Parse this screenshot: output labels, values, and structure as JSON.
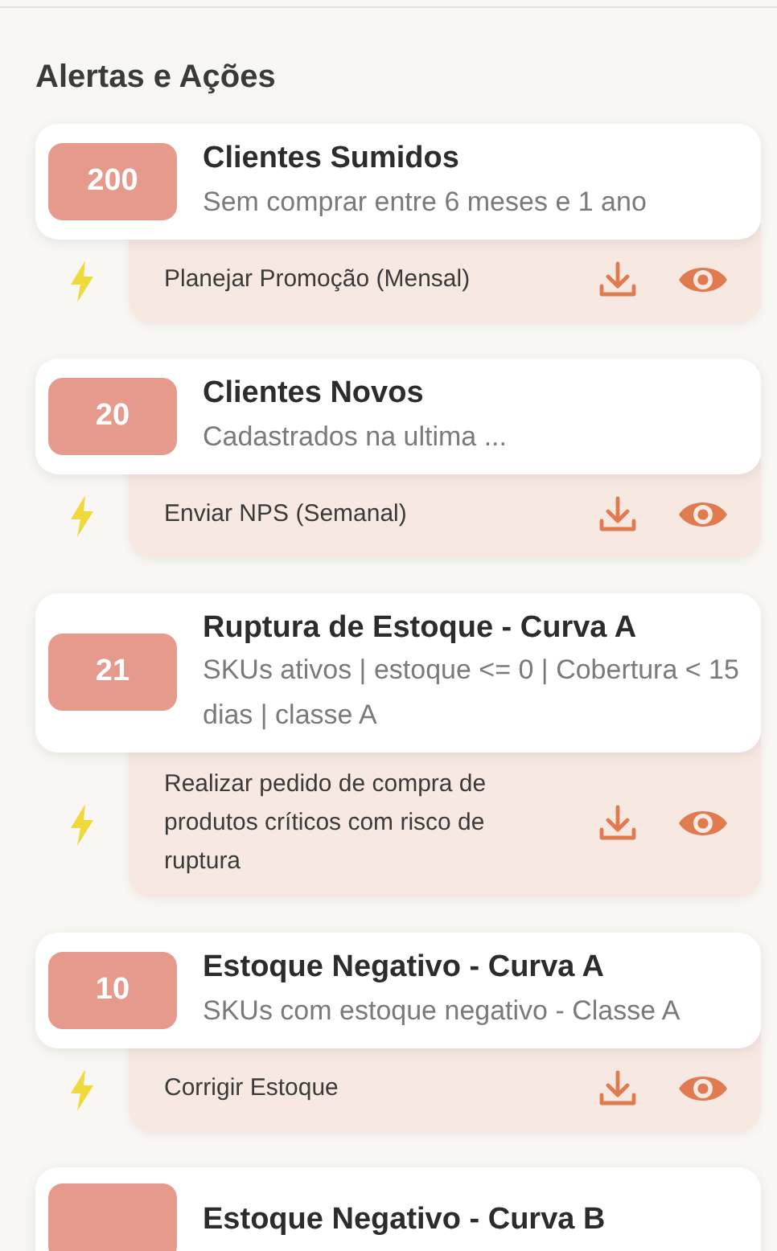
{
  "heading": "Alertas e Ações",
  "alerts": [
    {
      "count": "200",
      "title": "Clientes Sumidos",
      "description": "Sem comprar entre 6 meses e 1 ano",
      "action": "Planejar Promoção (Mensal)"
    },
    {
      "count": "20",
      "title": "Clientes Novos",
      "description": "Cadastrados na ultima ...",
      "action": "Enviar NPS (Semanal)"
    },
    {
      "count": "21",
      "title": "Ruptura de Estoque - Curva A",
      "description": "SKUs ativos | estoque <= 0 | Cobertura < 15 dias | classe A",
      "action": "Realizar pedido de compra de produtos críticos com risco de ruptura"
    },
    {
      "count": "10",
      "title": "Estoque Negativo - Curva A",
      "description": "SKUs com estoque negativo - Classe A",
      "action": "Corrigir Estoque"
    },
    {
      "title": "Estoque Negativo - Curva B"
    }
  ]
}
